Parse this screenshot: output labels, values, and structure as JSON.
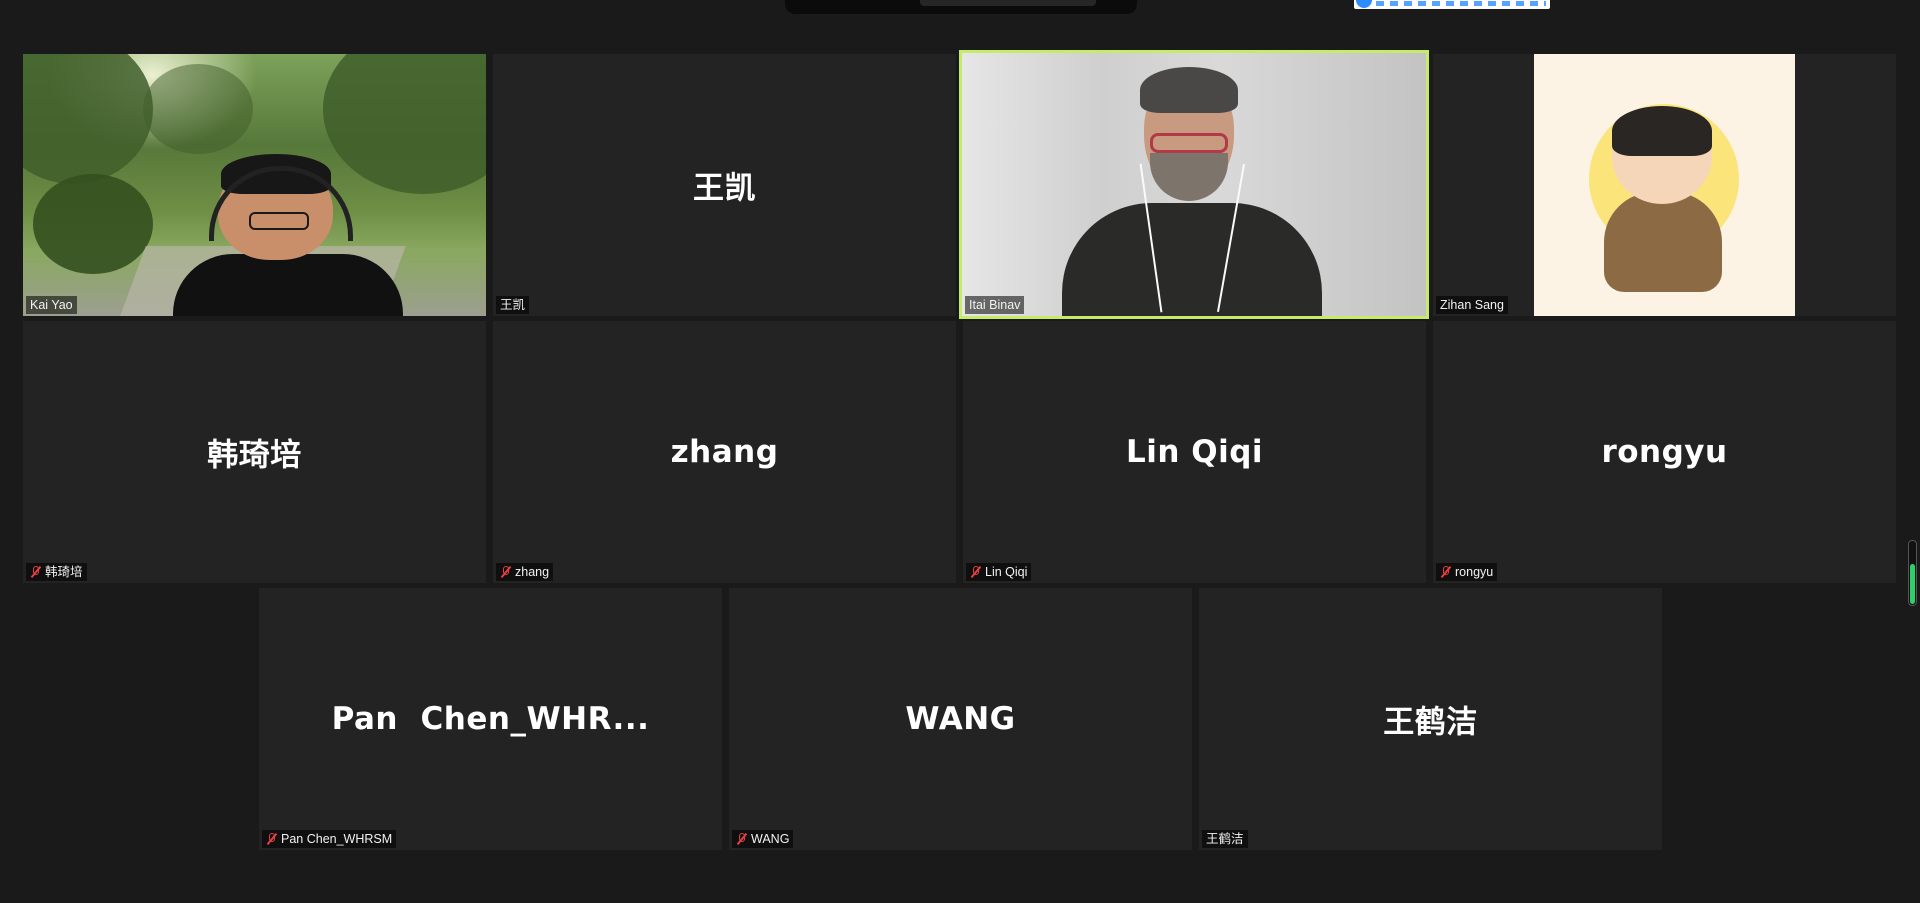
{
  "window": {
    "title": ""
  },
  "colors": {
    "speaking_border": "#c4ec6a",
    "muted_icon": "#e84040",
    "tile_bg": "#232323"
  },
  "participants": [
    {
      "name": "Kai Yao",
      "muted": false,
      "video": true
    },
    {
      "name": "王凯",
      "display": "王凯",
      "muted": false,
      "video": false
    },
    {
      "name": "Itai Binav",
      "muted": false,
      "video": true,
      "speaking": true
    },
    {
      "name": "Zihan Sang",
      "muted": false,
      "video": false,
      "avatar": "monk-avatar"
    },
    {
      "name": "韩琦培",
      "display": "韩琦培",
      "muted": true,
      "video": false
    },
    {
      "name": "zhang",
      "display": "zhang",
      "muted": true,
      "video": false
    },
    {
      "name": "Lin Qiqi",
      "display": "Lin Qiqi",
      "muted": true,
      "video": false
    },
    {
      "name": "rongyu",
      "display": "rongyu",
      "muted": true,
      "video": false
    },
    {
      "name": "Pan Chen_WHRSM",
      "display": "Pan  Chen_WHR...",
      "muted": true,
      "video": false
    },
    {
      "name": "WANG",
      "display": "WANG",
      "muted": true,
      "video": false
    },
    {
      "name": "王鹤洁",
      "display": "王鹤洁",
      "muted": false,
      "video": false
    }
  ],
  "scrollbar": {
    "level": 0.65
  }
}
